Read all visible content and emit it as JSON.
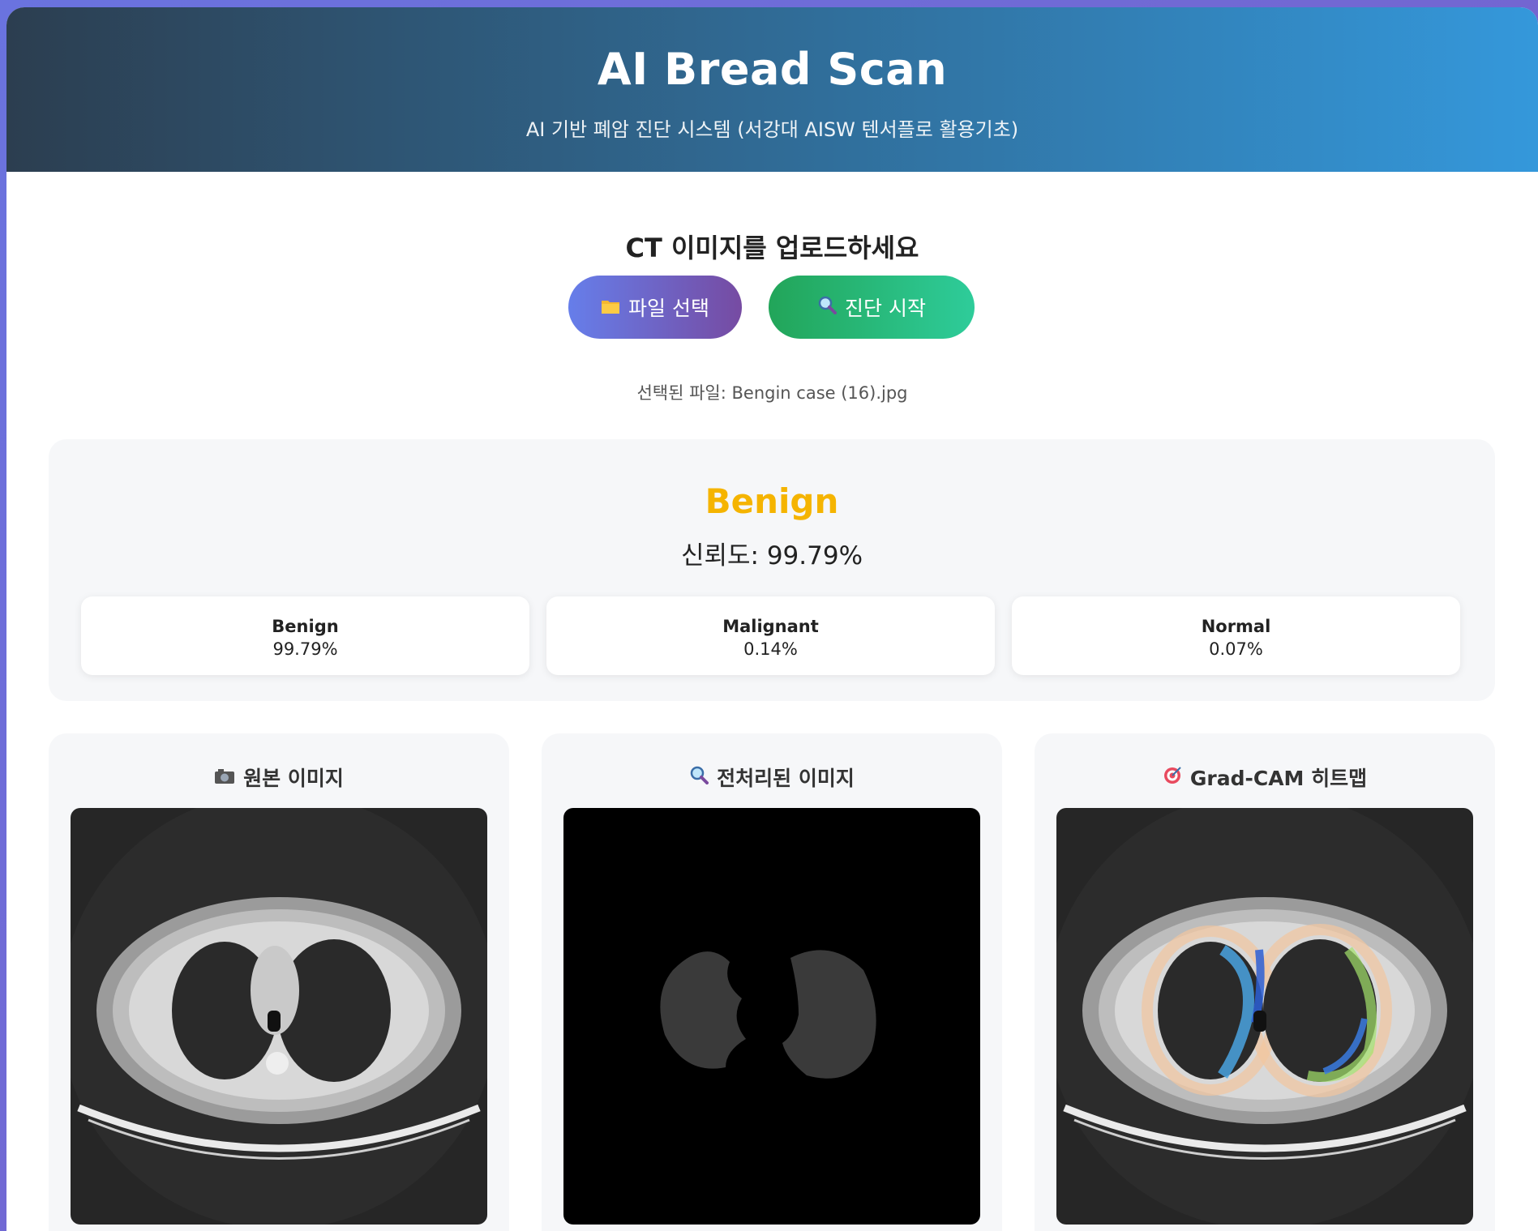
{
  "header": {
    "title": "AI Bread Scan",
    "subtitle": "AI 기반 폐암 진단 시스템 (서강대 AISW 텐서플로 활용기초)"
  },
  "upload": {
    "title": "CT 이미지를 업로드하세요",
    "file_button_icon": "folder-icon",
    "file_button_label": "파일 선택",
    "start_button_icon": "magnifier-icon",
    "start_button_label": "진단 시작",
    "selected_file": "선택된 파일: Bengin case (16).jpg"
  },
  "result": {
    "label": "Benign",
    "label_color": "#f5b400",
    "confidence": "신뢰도: 99.79%",
    "probabilities": [
      {
        "name": "Benign",
        "value": "99.79%"
      },
      {
        "name": "Malignant",
        "value": "0.14%"
      },
      {
        "name": "Normal",
        "value": "0.07%"
      }
    ]
  },
  "panels": [
    {
      "icon": "camera-icon",
      "title": "원본 이미지"
    },
    {
      "icon": "magnifier-icon",
      "title": "전처리된 이미지"
    },
    {
      "icon": "target-icon",
      "title": "Grad-CAM 히트맵"
    }
  ],
  "colors": {
    "header_start": "#2c3e50",
    "header_end": "#3498db",
    "file_button": "#667eea",
    "start_button": "#22a559"
  }
}
